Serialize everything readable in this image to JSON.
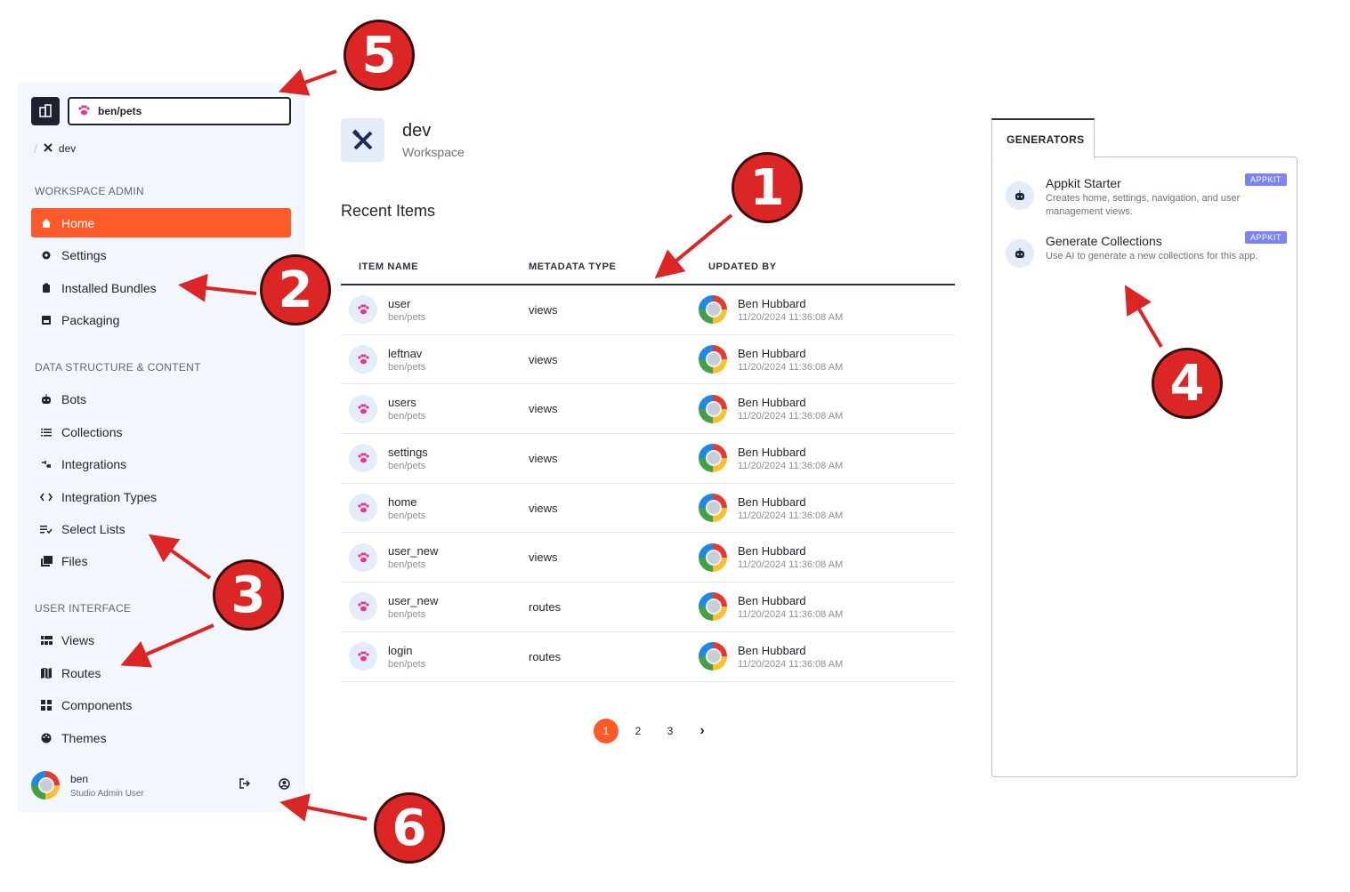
{
  "sidebar": {
    "app_selector": "ben/pets",
    "breadcrumb": "dev",
    "sections": [
      {
        "heading": "WORKSPACE ADMIN",
        "items": [
          {
            "label": "Home",
            "icon": "home-icon",
            "active": true
          },
          {
            "label": "Settings",
            "icon": "gear-icon"
          },
          {
            "label": "Installed Bundles",
            "icon": "bundle-icon"
          },
          {
            "label": "Packaging",
            "icon": "package-icon"
          }
        ]
      },
      {
        "heading": "DATA STRUCTURE & CONTENT",
        "items": [
          {
            "label": "Bots",
            "icon": "bot-icon"
          },
          {
            "label": "Collections",
            "icon": "list-icon"
          },
          {
            "label": "Integrations",
            "icon": "integration-icon"
          },
          {
            "label": "Integration Types",
            "icon": "code-icon"
          },
          {
            "label": "Select Lists",
            "icon": "select-list-icon"
          },
          {
            "label": "Files",
            "icon": "files-icon"
          }
        ]
      },
      {
        "heading": "USER INTERFACE",
        "items": [
          {
            "label": "Views",
            "icon": "views-icon"
          },
          {
            "label": "Routes",
            "icon": "map-icon"
          },
          {
            "label": "Components",
            "icon": "components-icon"
          },
          {
            "label": "Themes",
            "icon": "palette-icon"
          }
        ]
      }
    ],
    "user": {
      "name": "ben",
      "role": "Studio Admin User"
    }
  },
  "workspace": {
    "title": "dev",
    "subtitle": "Workspace"
  },
  "recent": {
    "title": "Recent Items",
    "columns": [
      "ITEM NAME",
      "METADATA TYPE",
      "UPDATED BY"
    ],
    "rows": [
      {
        "name": "user",
        "ns": "ben/pets",
        "type": "views",
        "by": "Ben Hubbard",
        "date": "11/20/2024 11:36:08 AM"
      },
      {
        "name": "leftnav",
        "ns": "ben/pets",
        "type": "views",
        "by": "Ben Hubbard",
        "date": "11/20/2024 11:36:08 AM"
      },
      {
        "name": "users",
        "ns": "ben/pets",
        "type": "views",
        "by": "Ben Hubbard",
        "date": "11/20/2024 11:36:08 AM"
      },
      {
        "name": "settings",
        "ns": "ben/pets",
        "type": "views",
        "by": "Ben Hubbard",
        "date": "11/20/2024 11:36:08 AM"
      },
      {
        "name": "home",
        "ns": "ben/pets",
        "type": "views",
        "by": "Ben Hubbard",
        "date": "11/20/2024 11:36:08 AM"
      },
      {
        "name": "user_new",
        "ns": "ben/pets",
        "type": "views",
        "by": "Ben Hubbard",
        "date": "11/20/2024 11:36:08 AM"
      },
      {
        "name": "user_new",
        "ns": "ben/pets",
        "type": "routes",
        "by": "Ben Hubbard",
        "date": "11/20/2024 11:36:08 AM"
      },
      {
        "name": "login",
        "ns": "ben/pets",
        "type": "routes",
        "by": "Ben Hubbard",
        "date": "11/20/2024 11:36:08 AM"
      }
    ],
    "pagination": {
      "pages": [
        "1",
        "2",
        "3"
      ],
      "current": "1",
      "next": "›"
    }
  },
  "generators": {
    "tab": "GENERATORS",
    "items": [
      {
        "title": "Appkit Starter",
        "desc": "Creates home, settings, navigation, and user management views.",
        "badge": "APPKIT"
      },
      {
        "title": "Generate Collections",
        "desc": "Use AI to generate a new collections for this app.",
        "badge": "APPKIT"
      }
    ]
  },
  "annotations": [
    "1",
    "2",
    "3",
    "4",
    "5",
    "6"
  ],
  "colors": {
    "accent": "#ff5b2a",
    "annotation": "#dc2626",
    "badge": "#7c83f7",
    "sidebar_bg": "#f2f7fd",
    "paw": "#e5368a"
  }
}
